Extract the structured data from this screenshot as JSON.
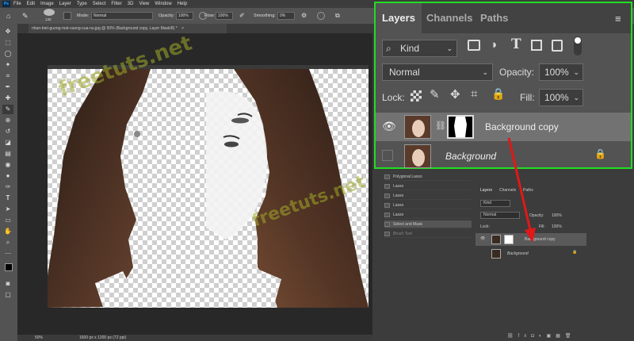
{
  "menubar": {
    "logo": "Ps",
    "items": [
      "File",
      "Edit",
      "Image",
      "Layer",
      "Type",
      "Select",
      "Filter",
      "3D",
      "View",
      "Window",
      "Help"
    ]
  },
  "options": {
    "brush_size": "130",
    "mode_label": "Mode:",
    "mode_value": "Normal",
    "opacity_label": "Opacity:",
    "opacity_value": "100%",
    "flow_label": "Flow:",
    "flow_value": "100%",
    "smoothing_label": "Smoothing:",
    "smoothing_value": "0%"
  },
  "document": {
    "tab_title": "nhan-biet-guong-mat-vuong-cua-nu.jpg @ 50% (Background copy, Layer Mask/8) *",
    "tab_close": "×",
    "zoom": "50%",
    "dimensions": "1600 px x 1200 px (72 ppi)"
  },
  "history": {
    "items": [
      "Polygonal Lasso",
      "Lasso",
      "Lasso",
      "Lasso",
      "Lasso",
      "Select and Mask",
      "Brush Tool"
    ]
  },
  "small_layers": {
    "tabs": [
      "Layers",
      "Channels",
      "Paths"
    ],
    "kind": "Kind",
    "blend": "Normal",
    "opacity_label": "Opacity:",
    "opacity_value": "100%",
    "lock_label": "Lock:",
    "fill_label": "Fill:",
    "fill_value": "100%",
    "layers": [
      {
        "name": "Background copy"
      },
      {
        "name": "Background"
      }
    ]
  },
  "layers_panel": {
    "tabs": [
      "Layers",
      "Channels",
      "Paths"
    ],
    "kind_label": "Kind",
    "blend_mode": "Normal",
    "opacity_label": "Opacity:",
    "opacity_value": "100%",
    "lock_label": "Lock:",
    "fill_label": "Fill:",
    "fill_value": "100%",
    "layers": [
      {
        "name": "Background copy",
        "visible": true,
        "selected": true
      },
      {
        "name": "Background",
        "visible": false,
        "selected": false
      }
    ]
  },
  "watermark": "freetuts.net",
  "colors": {
    "callout_border": "#22dd22",
    "arrow": "#e01818",
    "accent_blue": "#31a8ff"
  }
}
